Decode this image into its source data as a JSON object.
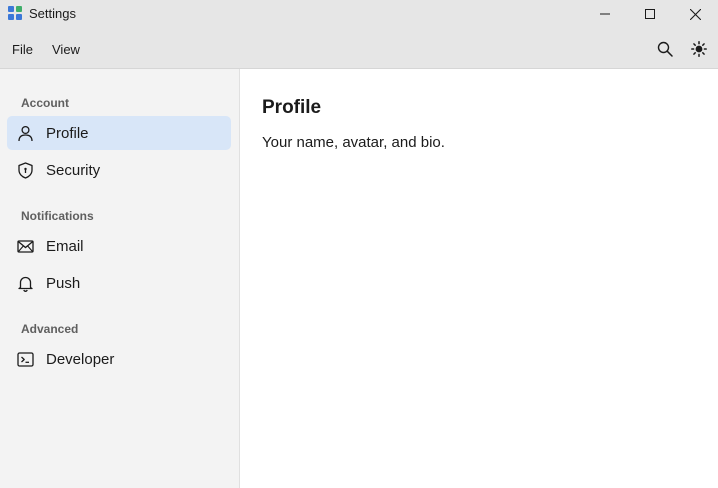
{
  "window": {
    "title": "Settings"
  },
  "menu": {
    "file": "File",
    "view": "View"
  },
  "toolbar": {
    "search_icon": "search-icon",
    "theme_icon": "sun-icon"
  },
  "sidebar": {
    "groups": [
      {
        "label": "Account",
        "items": [
          {
            "label": "Profile",
            "icon": "person-icon",
            "selected": true
          },
          {
            "label": "Security",
            "icon": "shield-icon",
            "selected": false
          }
        ]
      },
      {
        "label": "Notifications",
        "items": [
          {
            "label": "Email",
            "icon": "mail-icon",
            "selected": false
          },
          {
            "label": "Push",
            "icon": "bell-icon",
            "selected": false
          }
        ]
      },
      {
        "label": "Advanced",
        "items": [
          {
            "label": "Developer",
            "icon": "terminal-icon",
            "selected": false
          }
        ]
      }
    ]
  },
  "main": {
    "title": "Profile",
    "description": "Your name, avatar, and bio."
  },
  "colors": {
    "chrome": "#e6e6e6",
    "sidebar": "#f3f3f3",
    "selected": "#d8e6f8",
    "app_icon_blue": "#3b78d8",
    "app_icon_green": "#3fae6a"
  }
}
